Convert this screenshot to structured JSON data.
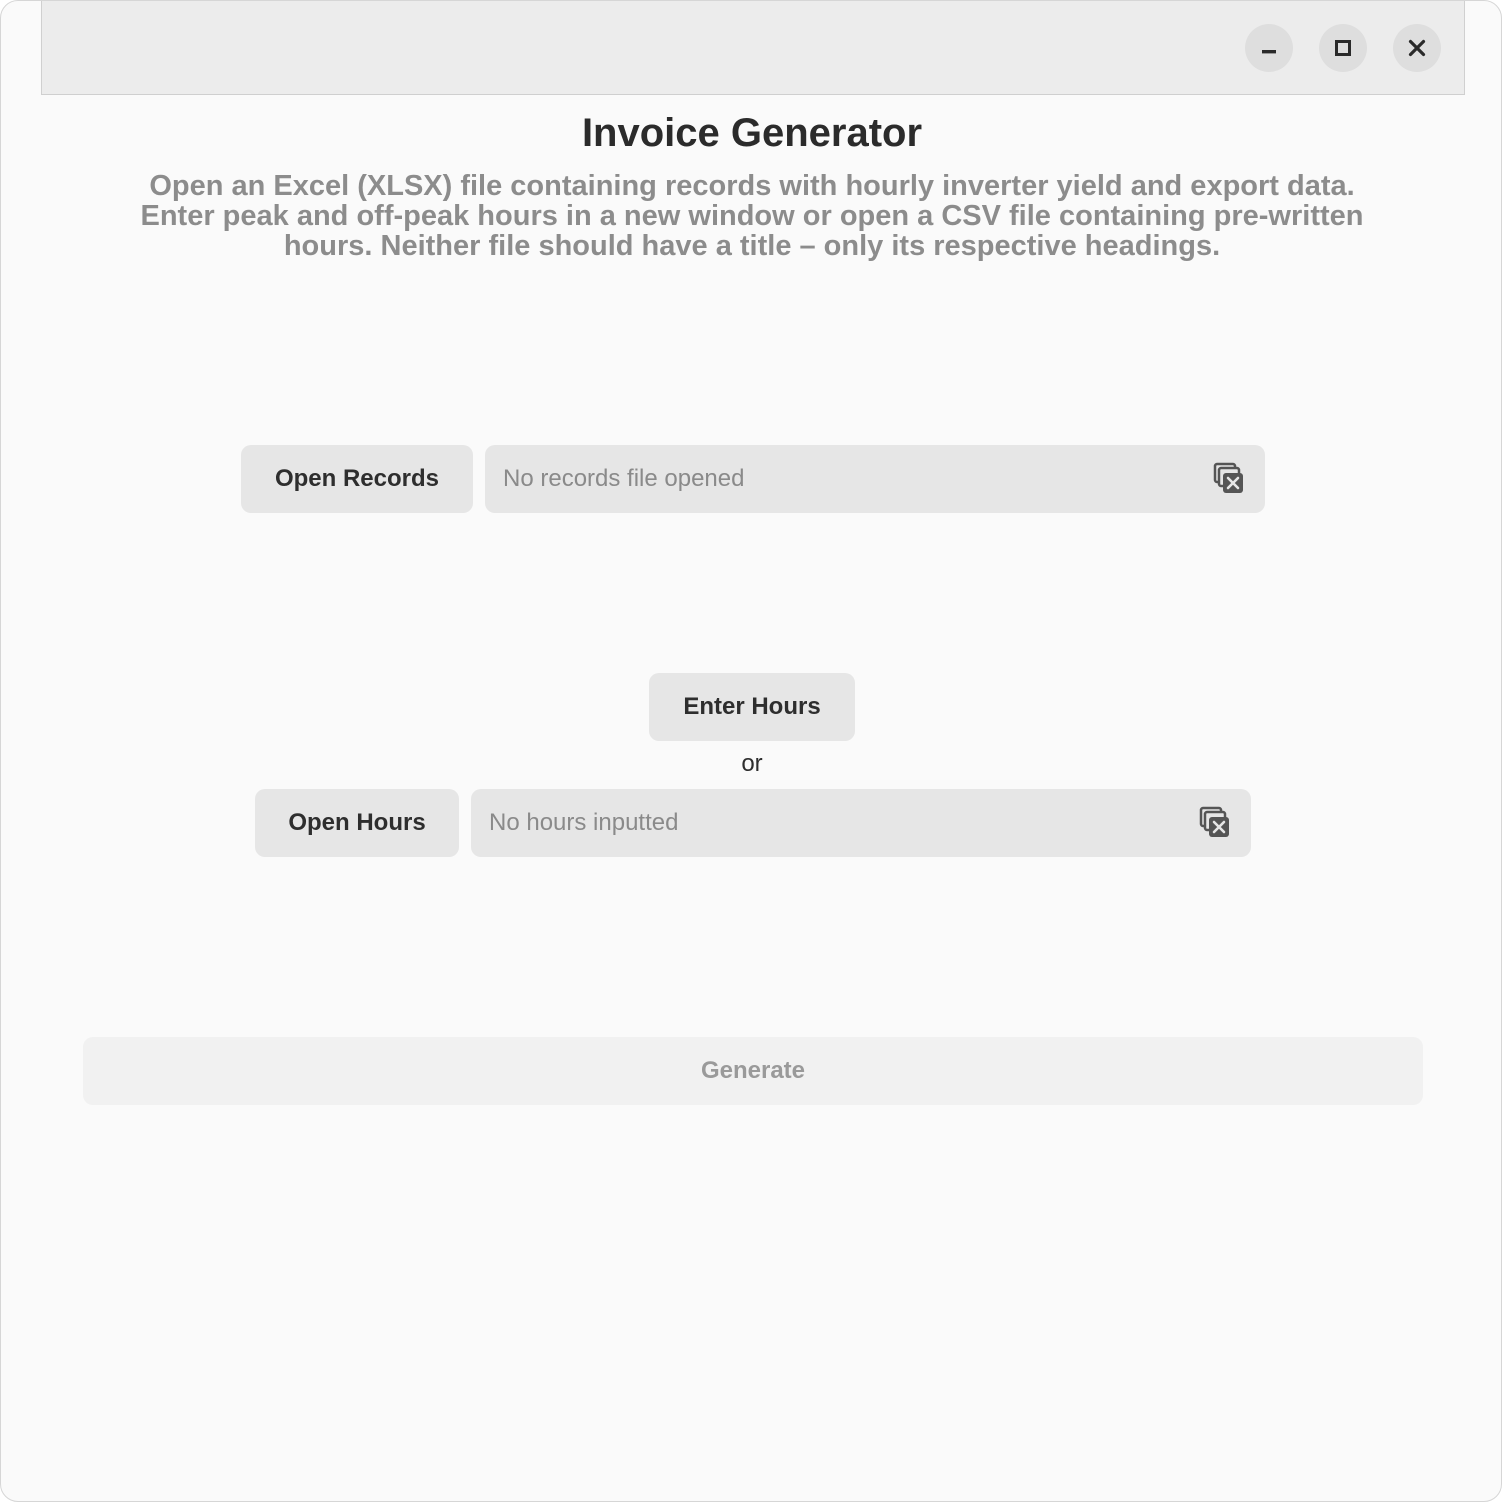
{
  "window": {
    "controls": {
      "minimize_icon": "minimize-icon",
      "maximize_icon": "maximize-icon",
      "close_icon": "close-icon"
    }
  },
  "header": {
    "title": "Invoice Generator",
    "description": "Open an Excel (XLSX) file containing records with hourly inverter yield and export data. Enter peak and off-peak hours in a new window or open a CSV file containing pre-written hours. Neither file should have a title – only its respective headings."
  },
  "records": {
    "button_label": "Open Records",
    "field_text": "No records file opened",
    "clear_icon": "clear-file-icon"
  },
  "hours": {
    "enter_button_label": "Enter Hours",
    "or_label": "or",
    "open_button_label": "Open Hours",
    "field_text": "No hours inputted",
    "clear_icon": "clear-file-icon"
  },
  "generate": {
    "label": "Generate"
  },
  "colors": {
    "background": "#fafafa",
    "titlebar": "#ececec",
    "button": "#e6e6e6",
    "disabled_text": "#9a9a9a"
  }
}
